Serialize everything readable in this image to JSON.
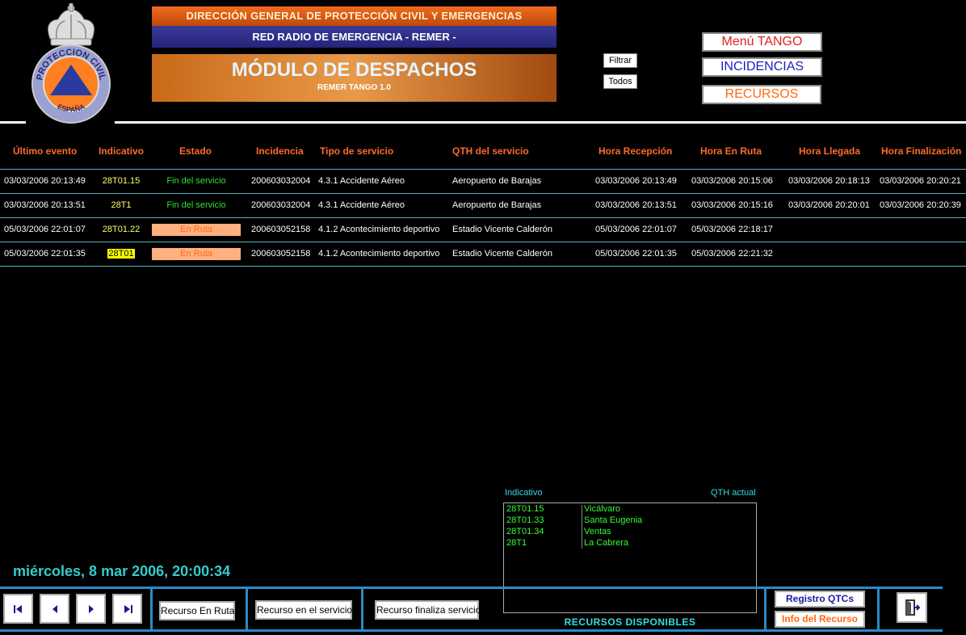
{
  "header": {
    "line1": "DIRECCIÓN GENERAL DE PROTECCIÓN CIVIL Y EMERGENCIAS",
    "line2": "RED RADIO DE EMERGENCIA - REMER -",
    "title": "MÓDULO DE DESPACHOS",
    "subtitle": "REMER TANGO 1.0",
    "logo_text_top": "PROTECCION CIVIL",
    "logo_text_bottom": "ESPAÑA"
  },
  "filters": {
    "filter_label": "Filtrar",
    "all_label": "Todos"
  },
  "nav": {
    "menu_label": "Menú TANGO",
    "incidencias_label": "INCIDENCIAS",
    "recursos_label": "RECURSOS",
    "menu_color": "#e02020",
    "incidencias_color": "#2020c0",
    "recursos_color": "#ff6a10"
  },
  "table": {
    "columns": [
      "Último evento",
      "Indicativo",
      "Estado",
      "Incidencia",
      "Tipo de servicio",
      "QTH del servicio",
      "Hora Recepción",
      "Hora En Ruta",
      "Hora Llegada",
      "Hora Finalización"
    ],
    "rows": [
      {
        "ultimo": "03/03/2006 20:13:49",
        "indicativo": "28T01.15",
        "estado": "Fin del servicio",
        "incidencia": "200603032004",
        "tipo": "4.3.1 Accidente Aéreo",
        "qth": "Aeropuerto de Barajas",
        "recepcion": "03/03/2006 20:13:49",
        "ruta": "03/03/2006 20:15:06",
        "llegada": "03/03/2006 20:18:13",
        "finalizacion": "03/03/2006 20:20:21"
      },
      {
        "ultimo": "03/03/2006 20:13:51",
        "indicativo": "28T1",
        "estado": "Fin del servicio",
        "incidencia": "200603032004",
        "tipo": "4.3.1 Accidente Aéreo",
        "qth": "Aeropuerto de Barajas",
        "recepcion": "03/03/2006 20:13:51",
        "ruta": "03/03/2006 20:15:16",
        "llegada": "03/03/2006 20:20:01",
        "finalizacion": "03/03/2006 20:20:39"
      },
      {
        "ultimo": "05/03/2006 22:01:07",
        "indicativo": "28T01.22",
        "estado": "En Ruta",
        "incidencia": "200603052158",
        "tipo": "4.1.2 Acontecimiento deportivo",
        "qth": "Estadio Vicente Calderón",
        "recepcion": "05/03/2006 22:01:07",
        "ruta": "05/03/2006 22:18:17",
        "llegada": "",
        "finalizacion": ""
      },
      {
        "ultimo": "05/03/2006 22:01:35",
        "indicativo": "28T01",
        "estado": "En Ruta",
        "incidencia": "200603052158",
        "tipo": "4.1.2 Acontecimiento deportivo",
        "qth": "Estadio Vicente Calderón",
        "recepcion": "05/03/2006 22:01:35",
        "ruta": "05/03/2006 22:21:32",
        "llegada": "",
        "finalizacion": ""
      }
    ]
  },
  "resources": {
    "col_indicativo": "Indicativo",
    "col_qth": "QTH actual",
    "title": "RECURSOS DISPONIBLES",
    "items": [
      {
        "indicativo": "28T01.15",
        "qth": "Vicálvaro"
      },
      {
        "indicativo": "28T01.33",
        "qth": "Santa Eugenia"
      },
      {
        "indicativo": "28T01.34",
        "qth": "Ventas"
      },
      {
        "indicativo": "28T1",
        "qth": "La Cabrera"
      }
    ]
  },
  "datetime": "miércoles, 8 mar 2006, 20:00:34",
  "toolbar": {
    "first_icon": "first-record-icon",
    "prev_icon": "prev-record-icon",
    "next_icon": "next-record-icon",
    "last_icon": "last-record-icon",
    "btn_en_ruta": "Recurso En Ruta",
    "btn_en_servicio": "Recurso en el servicio",
    "btn_finaliza": "Recurso finaliza servicio",
    "btn_registro": "Registro QTCs",
    "btn_info": "Info del Recurso",
    "registro_color": "#1a1aa0",
    "info_color": "#ff6a10",
    "exit_icon": "exit-door-icon"
  }
}
